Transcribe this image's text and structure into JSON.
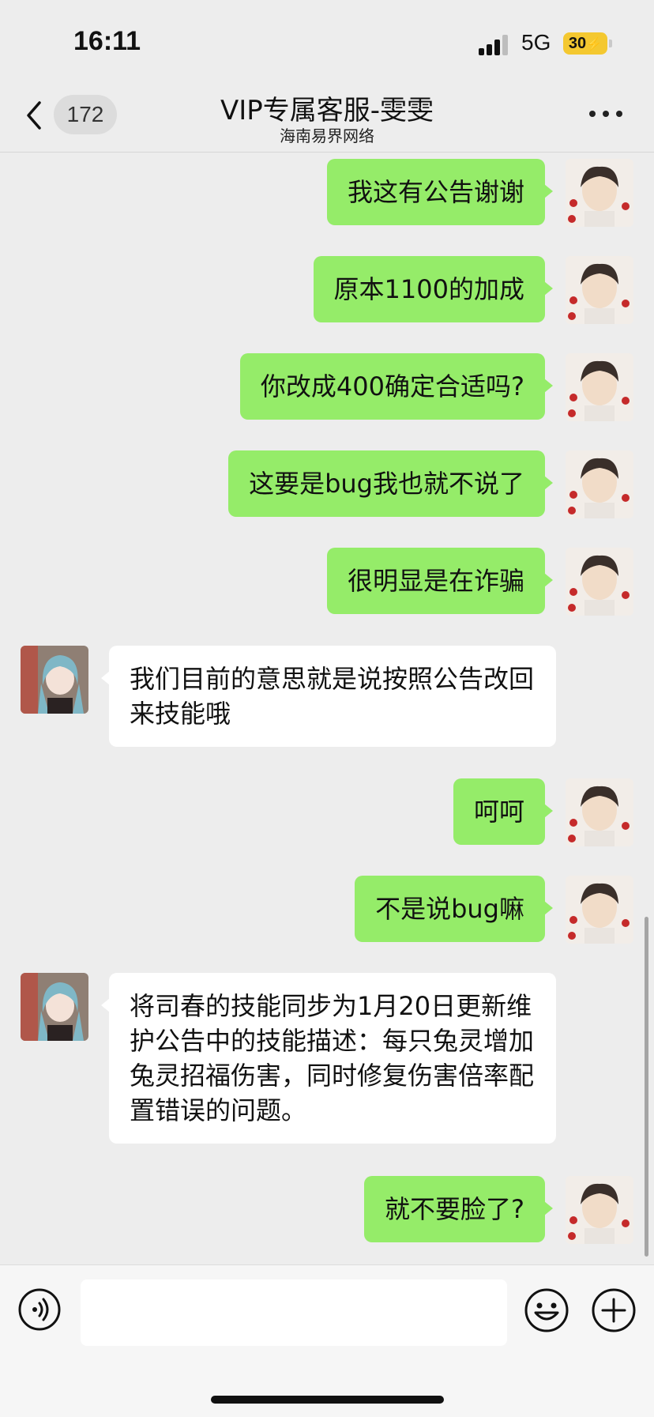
{
  "status": {
    "time": "16:11",
    "network": "5G",
    "battery": "30",
    "charging": true
  },
  "nav": {
    "back_count": "172",
    "title": "VIP专属客服-雯雯",
    "subtitle": "海南易界网络"
  },
  "messages": [
    {
      "side": "out",
      "text": "我这有公告谢谢"
    },
    {
      "side": "out",
      "text": "原本1100的加成"
    },
    {
      "side": "out",
      "text": "你改成400确定合适吗?"
    },
    {
      "side": "out",
      "text": "这要是bug我也就不说了"
    },
    {
      "side": "out",
      "text": "很明显是在诈骗"
    },
    {
      "side": "in",
      "text": "我们目前的意思就是说按照公告改回来技能哦"
    },
    {
      "side": "out",
      "text": "呵呵"
    },
    {
      "side": "out",
      "text": "不是说bug嘛"
    },
    {
      "side": "in",
      "text": "将司春的技能同步为1月20日更新维护公告中的技能描述：每只兔灵增加兔灵招福伤害，同时修复伤害倍率配置错误的问题。"
    },
    {
      "side": "out",
      "text": "就不要脸了?"
    }
  ],
  "input": {
    "value": ""
  },
  "colors": {
    "outgoing_bubble": "#95ec69",
    "incoming_bubble": "#ffffff",
    "background": "#ededed",
    "battery": "#f4c830"
  }
}
